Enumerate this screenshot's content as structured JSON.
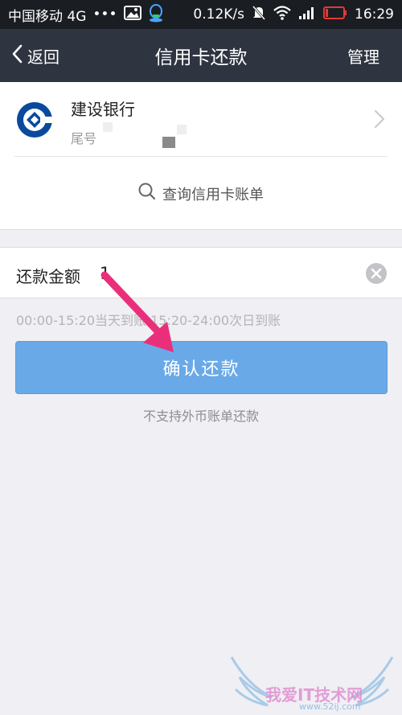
{
  "status_bar": {
    "carrier": "中国移动 4G",
    "dots": "•••",
    "speed": "0.12K/s",
    "time": "16:29"
  },
  "nav": {
    "back_label": "返回",
    "title": "信用卡还款",
    "manage_label": "管理"
  },
  "card": {
    "bank_name": "建设银行",
    "tail_label": "尾号",
    "query_label": "查询信用卡账单"
  },
  "amount": {
    "label": "还款金额",
    "value": "1"
  },
  "hint": "00:00-15:20当天到账 15:20-24:00次日到账",
  "confirm_label": "确认还款",
  "foreign_note": "不支持外币账单还款",
  "watermark": {
    "text": "我爱IT技术网",
    "url": "www.52ij.com"
  },
  "colors": {
    "status_bar_bg": "#1a1d22",
    "nav_bg": "#2e3440",
    "page_bg": "#efeff4",
    "button_blue": "#6aa9e8",
    "bank_blue": "#0a4a9e",
    "arrow_pink": "#ea2f7a"
  },
  "icons": {
    "back": "chevron-left-icon",
    "bank_logo": "ccb-logo-icon",
    "chevron": "chevron-right-icon",
    "search": "search-icon",
    "clear": "clear-circle-icon"
  }
}
